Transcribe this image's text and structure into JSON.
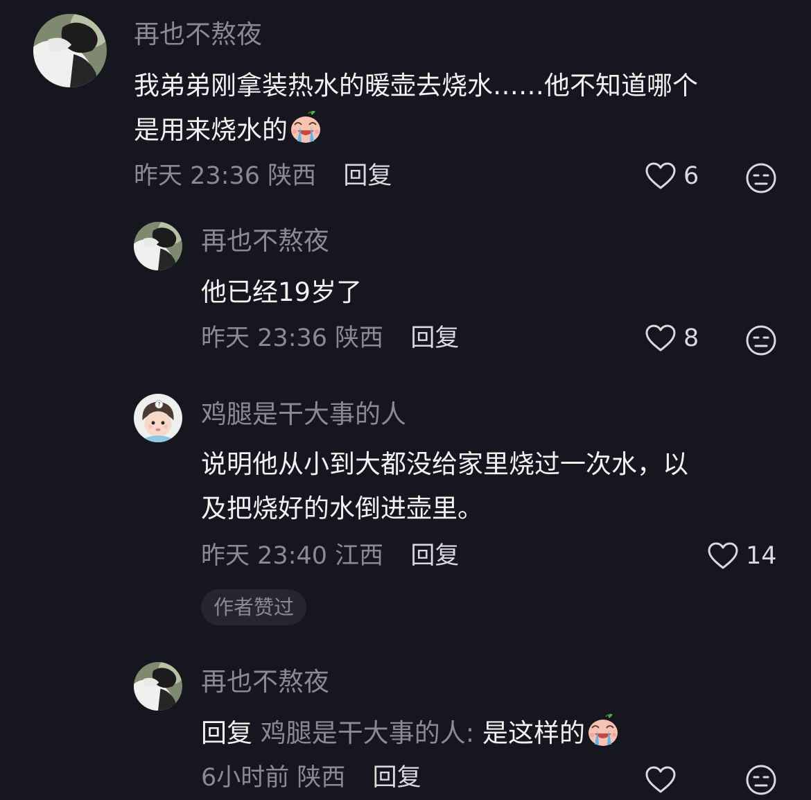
{
  "comments": [
    {
      "username": "再也不熬夜",
      "text_lines": [
        "我弟弟刚拿装热水的暖壶去烧水……他不知道哪个",
        "是用来烧水的"
      ],
      "emoji": "crying-laugh-emoji",
      "date": "昨天",
      "time": "23:36",
      "location": "陕西",
      "reply_label": "回复",
      "likes": "6",
      "avatar": "cat-avatar"
    },
    {
      "username": "再也不熬夜",
      "text_lines": [
        "他已经19岁了"
      ],
      "date": "昨天",
      "time": "23:36",
      "location": "陕西",
      "reply_label": "回复",
      "likes": "8",
      "avatar": "cat-avatar"
    },
    {
      "username": "鸡腿是干大事的人",
      "text_lines": [
        "说明他从小到大都没给家里烧过一次水，以",
        "及把烧好的水倒进壶里。"
      ],
      "date": "昨天",
      "time": "23:40",
      "location": "江西",
      "reply_label": "回复",
      "likes": "14",
      "badge": "作者赞过",
      "avatar": "baby-avatar"
    },
    {
      "username": "再也不熬夜",
      "reply_prefix": "回复",
      "reply_target": "鸡腿是干大事的人:",
      "text": "是这样的",
      "emoji": "crying-laugh-emoji",
      "date": "6小时前",
      "location": "陕西",
      "reply_label": "回复",
      "avatar": "cat-avatar"
    }
  ],
  "colors": {
    "background": "#16161e",
    "primary_text": "#f2f2f4",
    "secondary_text": "#8a8a94",
    "badge_bg": "#26262e"
  }
}
